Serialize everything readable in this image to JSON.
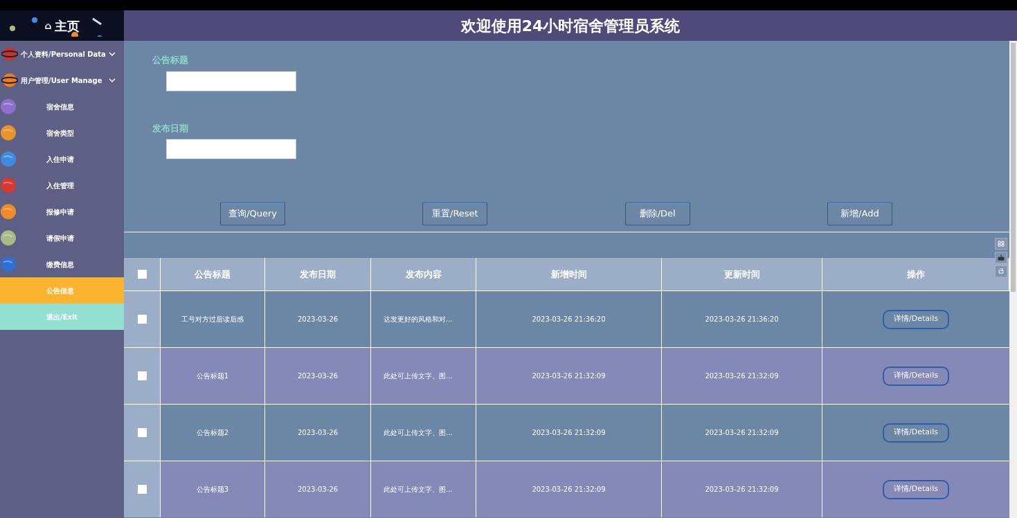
{
  "sidebar": {
    "home": {
      "icon": "⌂",
      "label": "主页"
    },
    "items": [
      {
        "label": "个人资料/Personal Data",
        "kind": "group",
        "selected": false
      },
      {
        "label": "用户管理/User Manage",
        "kind": "group",
        "selected": false
      },
      {
        "label": "宿舍信息",
        "kind": "link",
        "selected": false
      },
      {
        "label": "宿舍类型",
        "kind": "link",
        "selected": false
      },
      {
        "label": "入住申请",
        "kind": "link",
        "selected": false
      },
      {
        "label": "入住管理",
        "kind": "link",
        "selected": false
      },
      {
        "label": "报修申请",
        "kind": "link",
        "selected": false
      },
      {
        "label": "请假申请",
        "kind": "link",
        "selected": false
      },
      {
        "label": "缴费信息",
        "kind": "link",
        "selected": false
      },
      {
        "label": "公告信息",
        "kind": "plain",
        "selected": true
      },
      {
        "label": "退出/Exit",
        "kind": "exit",
        "selected": false
      }
    ]
  },
  "header": {
    "title": "欢迎使用24小时宿舍管理员系统"
  },
  "filters": [
    {
      "label": "公告标题"
    },
    {
      "label": "发布日期"
    }
  ],
  "actions": [
    "查询/Query",
    "重置/Reset",
    "删除/Del",
    "新增/Add"
  ],
  "table": {
    "columns": [
      "公告标题",
      "发布日期",
      "发布内容",
      "新增时间",
      "更新时间",
      "操作"
    ],
    "select_all": {
      "checked": false
    },
    "rows": [
      {
        "checked": false,
        "cells": [
          "工号对方过后读后感",
          "2023-03-26",
          "达发更好的风格和对...",
          "2023-03-26 21:36:20",
          "2023-03-26 21:36:20"
        ],
        "action": "详情/Details"
      },
      {
        "checked": false,
        "cells": [
          "公告标题1",
          "2023-03-26",
          "此处可上传文字、图...",
          "2023-03-26 21:32:09",
          "2023-03-26 21:32:09"
        ],
        "action": "详情/Details"
      },
      {
        "checked": false,
        "cells": [
          "公告标题2",
          "2023-03-26",
          "此处可上传文字、图...",
          "2023-03-26 21:32:09",
          "2023-03-26 21:32:09"
        ],
        "action": "详情/Details"
      },
      {
        "checked": false,
        "cells": [
          "公告标题3",
          "2023-03-26",
          "此处可上传文字、图...",
          "2023-03-26 21:32:09",
          "2023-03-26 21:32:09"
        ],
        "action": "详情/Details"
      }
    ]
  }
}
